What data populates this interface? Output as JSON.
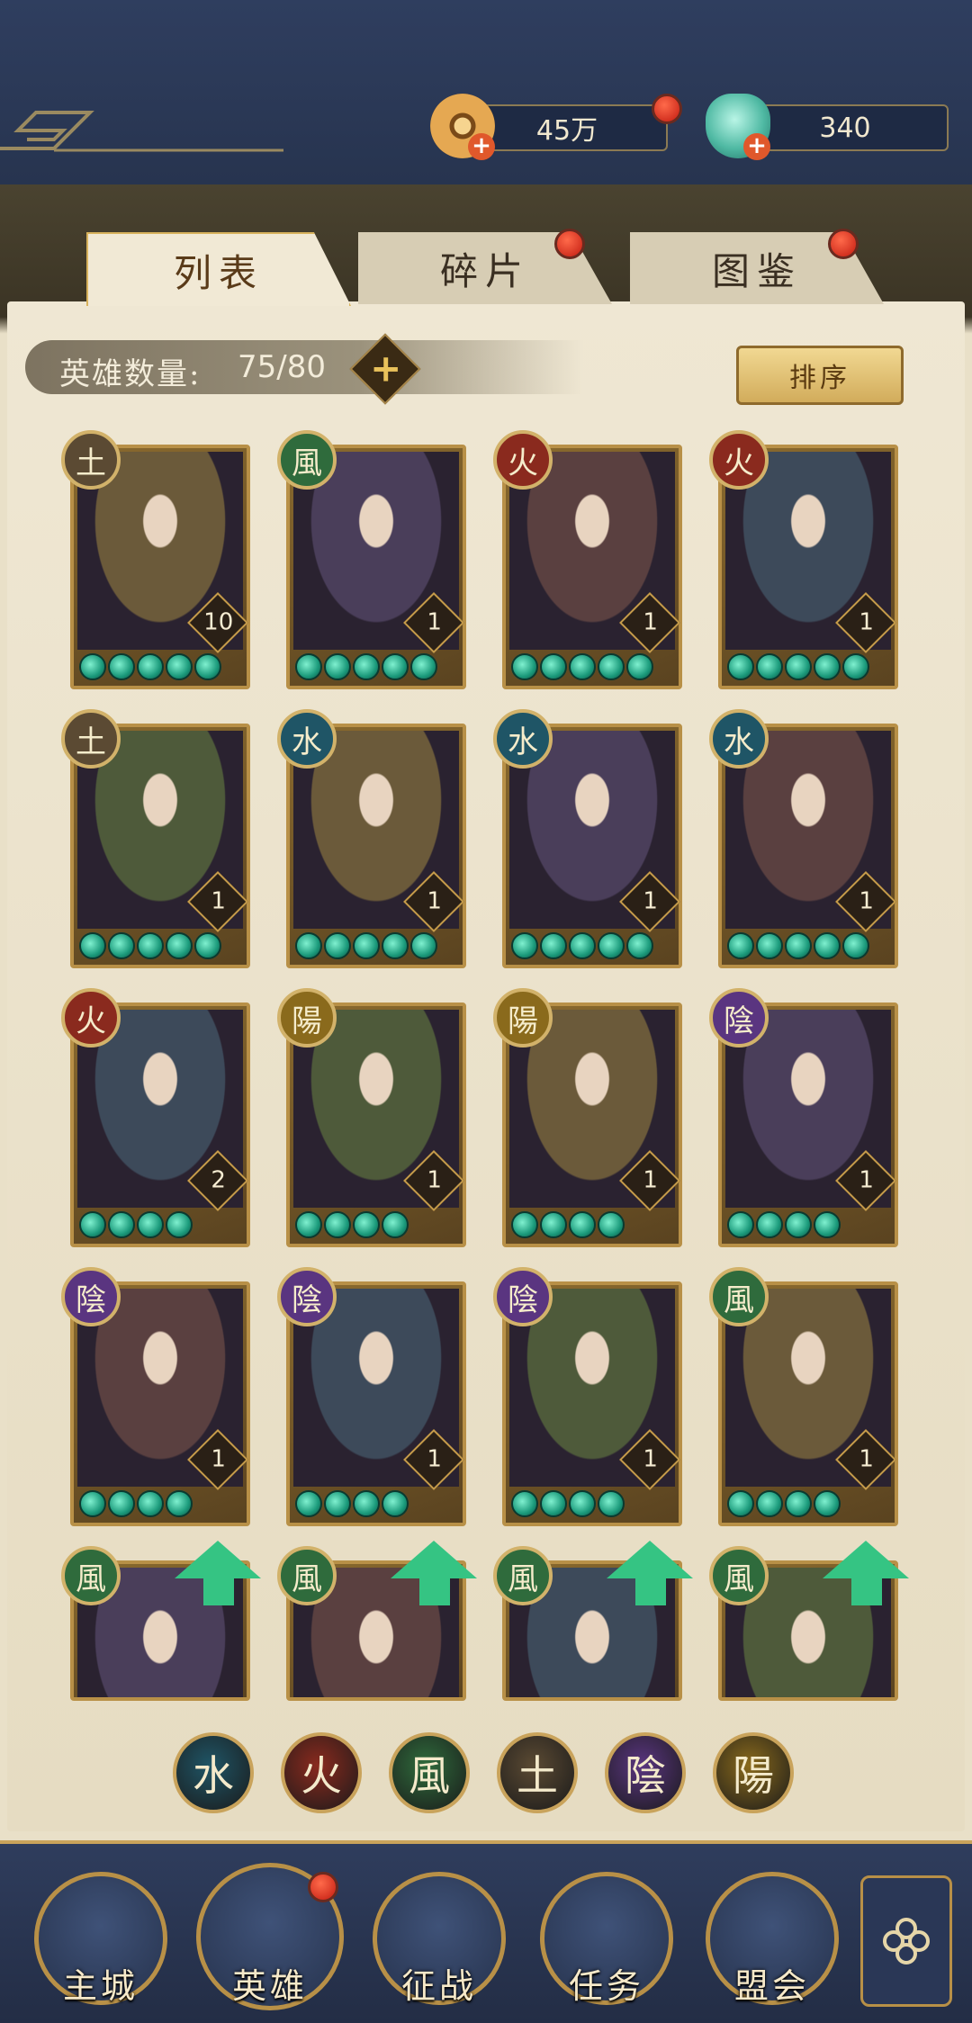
{
  "resources": {
    "copper": {
      "value": "45万",
      "icon": "copper-coin-icon"
    },
    "jade": {
      "value": "340",
      "icon": "jade-bag-icon"
    }
  },
  "tabs": [
    {
      "label": "列表",
      "active": true,
      "badge": false
    },
    {
      "label": "碎片",
      "active": false,
      "badge": true
    },
    {
      "label": "图鉴",
      "active": false,
      "badge": true
    }
  ],
  "hero_count": {
    "label": "英雄数量:",
    "value": "75/80"
  },
  "sort_label": "排序",
  "heroes": [
    {
      "element": "土",
      "level": "10",
      "stars": 5,
      "upgrade": false
    },
    {
      "element": "風",
      "level": "1",
      "stars": 5,
      "upgrade": false
    },
    {
      "element": "火",
      "level": "1",
      "stars": 5,
      "upgrade": false
    },
    {
      "element": "火",
      "level": "1",
      "stars": 5,
      "upgrade": false
    },
    {
      "element": "土",
      "level": "1",
      "stars": 5,
      "upgrade": false
    },
    {
      "element": "水",
      "level": "1",
      "stars": 5,
      "upgrade": false
    },
    {
      "element": "水",
      "level": "1",
      "stars": 5,
      "upgrade": false
    },
    {
      "element": "水",
      "level": "1",
      "stars": 5,
      "upgrade": false
    },
    {
      "element": "火",
      "level": "2",
      "stars": 4,
      "upgrade": false
    },
    {
      "element": "陽",
      "level": "1",
      "stars": 4,
      "upgrade": false
    },
    {
      "element": "陽",
      "level": "1",
      "stars": 4,
      "upgrade": false
    },
    {
      "element": "陰",
      "level": "1",
      "stars": 4,
      "upgrade": false
    },
    {
      "element": "陰",
      "level": "1",
      "stars": 4,
      "upgrade": false
    },
    {
      "element": "陰",
      "level": "1",
      "stars": 4,
      "upgrade": false
    },
    {
      "element": "陰",
      "level": "1",
      "stars": 4,
      "upgrade": false
    },
    {
      "element": "風",
      "level": "1",
      "stars": 4,
      "upgrade": false
    },
    {
      "element": "風",
      "level": "",
      "stars": 0,
      "upgrade": true
    },
    {
      "element": "風",
      "level": "",
      "stars": 0,
      "upgrade": true
    },
    {
      "element": "風",
      "level": "",
      "stars": 0,
      "upgrade": true
    },
    {
      "element": "風",
      "level": "",
      "stars": 0,
      "upgrade": true
    }
  ],
  "element_colors": {
    "土": "#5b4a33",
    "風": "#2f6b3c",
    "火": "#8a2a1e",
    "水": "#1f5566",
    "陽": "#8a6a1c",
    "陰": "#5a3580"
  },
  "filters": [
    "水",
    "火",
    "風",
    "土",
    "陰",
    "陽"
  ],
  "nav": [
    {
      "label": "主城",
      "icon": "city-gate-icon",
      "badge": false
    },
    {
      "label": "英雄",
      "icon": "hero-portrait-icon",
      "badge": true
    },
    {
      "label": "征战",
      "icon": "war-drum-icon",
      "badge": false
    },
    {
      "label": "任务",
      "icon": "task-scroll-icon",
      "badge": false
    },
    {
      "label": "盟会",
      "icon": "alliance-hall-icon",
      "badge": false
    }
  ],
  "menu_icon": "menu-flower-icon"
}
